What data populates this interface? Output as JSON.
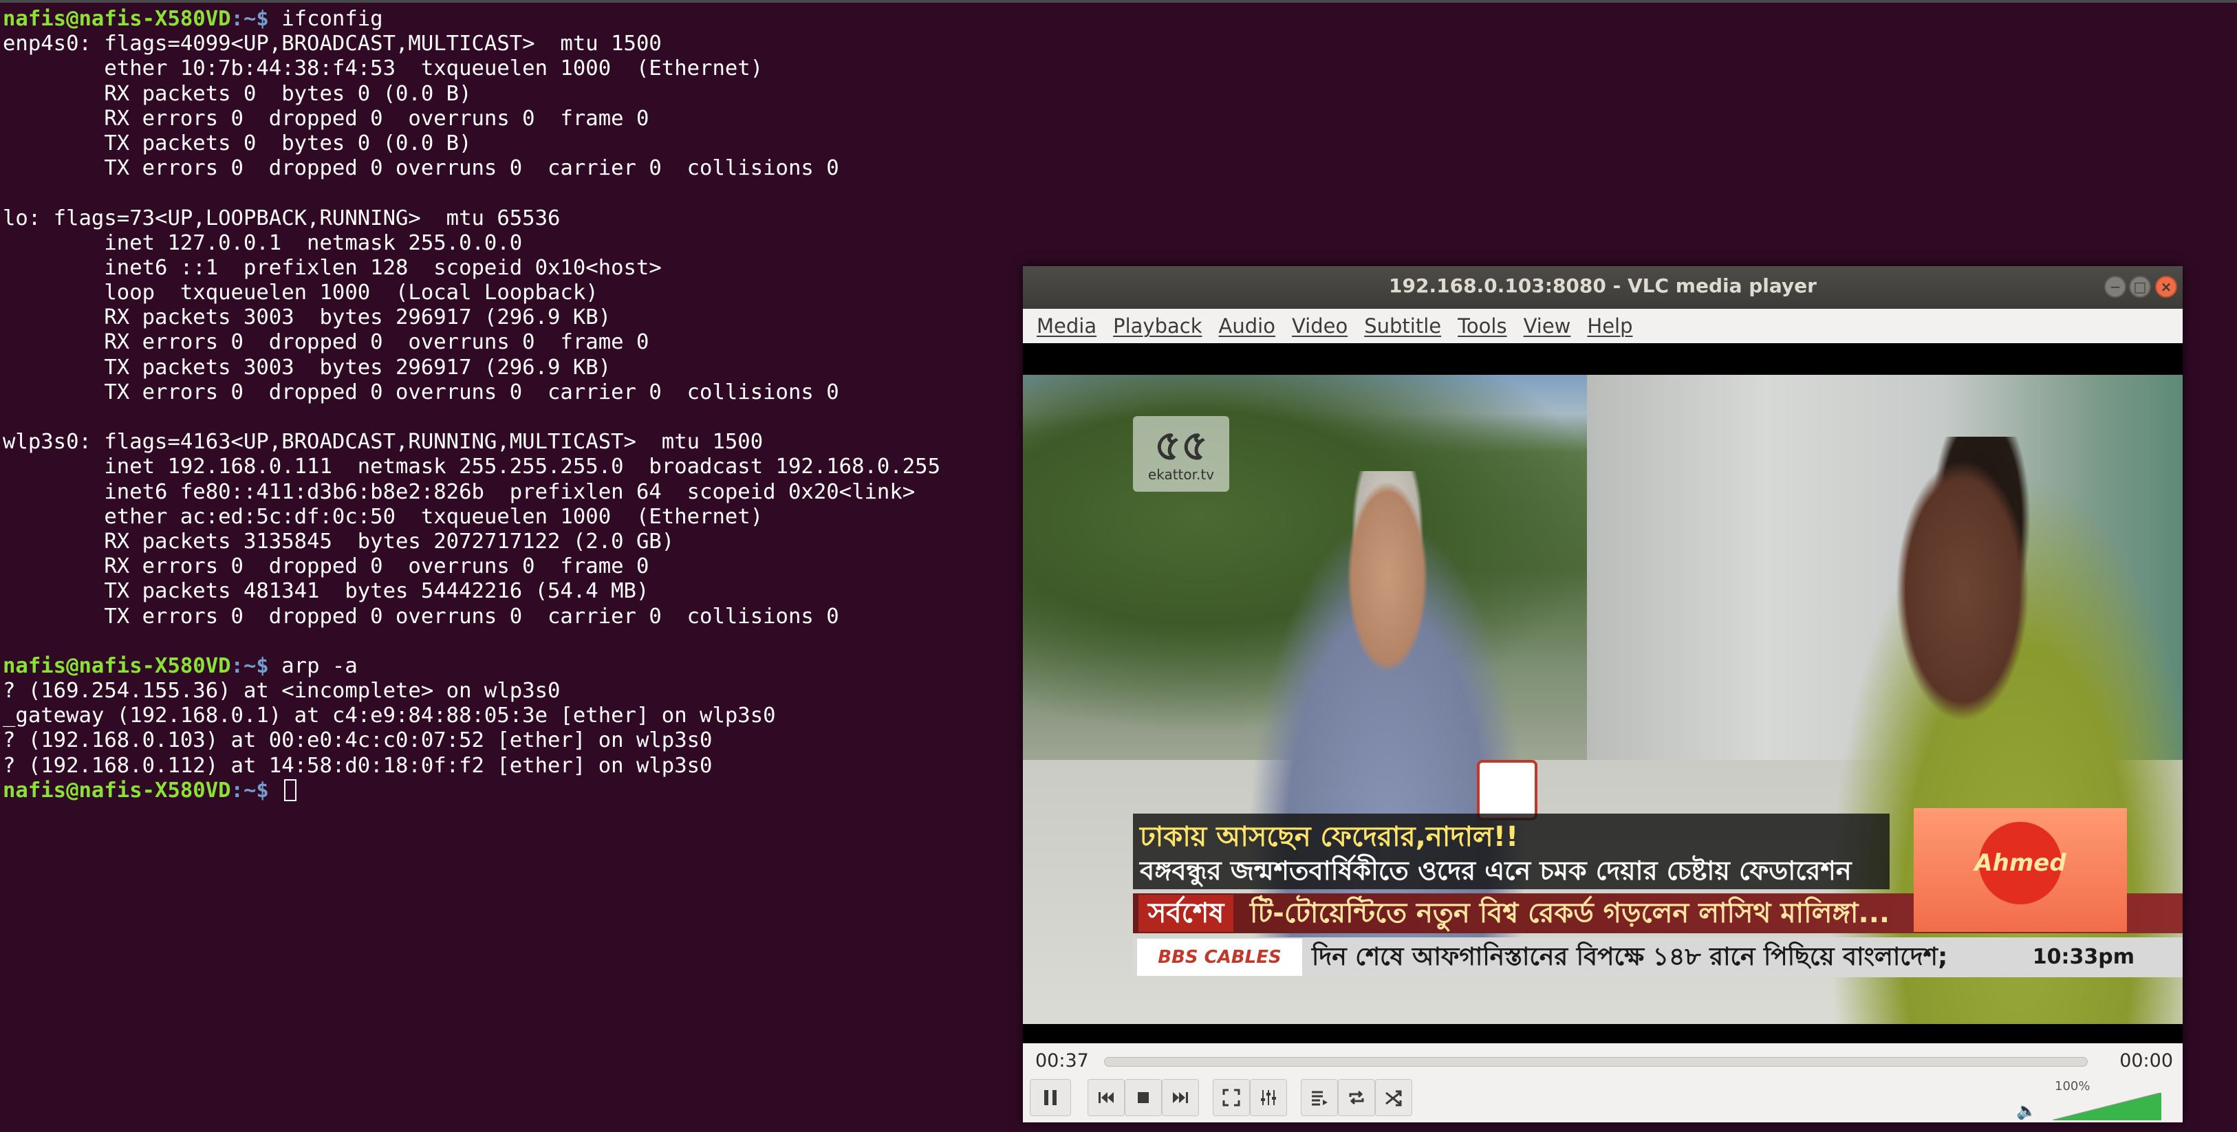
{
  "terminal": {
    "colors": {
      "background": "#300a24",
      "user": "#8ae234",
      "path": "#729fcf",
      "text": "#ffffff"
    },
    "prompt_user": "nafis@nafis-X580VD",
    "prompt_path": ":~$ ",
    "lines": [
      {
        "type": "prompt",
        "cmd": "ifconfig"
      },
      {
        "type": "out",
        "text": "enp4s0: flags=4099<UP,BROADCAST,MULTICAST>  mtu 1500"
      },
      {
        "type": "out",
        "text": "        ether 10:7b:44:38:f4:53  txqueuelen 1000  (Ethernet)"
      },
      {
        "type": "out",
        "text": "        RX packets 0  bytes 0 (0.0 B)"
      },
      {
        "type": "out",
        "text": "        RX errors 0  dropped 0  overruns 0  frame 0"
      },
      {
        "type": "out",
        "text": "        TX packets 0  bytes 0 (0.0 B)"
      },
      {
        "type": "out",
        "text": "        TX errors 0  dropped 0 overruns 0  carrier 0  collisions 0"
      },
      {
        "type": "out",
        "text": ""
      },
      {
        "type": "out",
        "text": "lo: flags=73<UP,LOOPBACK,RUNNING>  mtu 65536"
      },
      {
        "type": "out",
        "text": "        inet 127.0.0.1  netmask 255.0.0.0"
      },
      {
        "type": "out",
        "text": "        inet6 ::1  prefixlen 128  scopeid 0x10<host>"
      },
      {
        "type": "out",
        "text": "        loop  txqueuelen 1000  (Local Loopback)"
      },
      {
        "type": "out",
        "text": "        RX packets 3003  bytes 296917 (296.9 KB)"
      },
      {
        "type": "out",
        "text": "        RX errors 0  dropped 0  overruns 0  frame 0"
      },
      {
        "type": "out",
        "text": "        TX packets 3003  bytes 296917 (296.9 KB)"
      },
      {
        "type": "out",
        "text": "        TX errors 0  dropped 0 overruns 0  carrier 0  collisions 0"
      },
      {
        "type": "out",
        "text": ""
      },
      {
        "type": "out",
        "text": "wlp3s0: flags=4163<UP,BROADCAST,RUNNING,MULTICAST>  mtu 1500"
      },
      {
        "type": "out",
        "text": "        inet 192.168.0.111  netmask 255.255.255.0  broadcast 192.168.0.255"
      },
      {
        "type": "out",
        "text": "        inet6 fe80::411:d3b6:b8e2:826b  prefixlen 64  scopeid 0x20<link>"
      },
      {
        "type": "out",
        "text": "        ether ac:ed:5c:df:0c:50  txqueuelen 1000  (Ethernet)"
      },
      {
        "type": "out",
        "text": "        RX packets 3135845  bytes 2072717122 (2.0 GB)"
      },
      {
        "type": "out",
        "text": "        RX errors 0  dropped 0  overruns 0  frame 0"
      },
      {
        "type": "out",
        "text": "        TX packets 481341  bytes 54442216 (54.4 MB)"
      },
      {
        "type": "out",
        "text": "        TX errors 0  dropped 0 overruns 0  carrier 0  collisions 0"
      },
      {
        "type": "out",
        "text": ""
      },
      {
        "type": "prompt",
        "cmd": "arp -a"
      },
      {
        "type": "out",
        "text": "? (169.254.155.36) at <incomplete> on wlp3s0"
      },
      {
        "type": "out",
        "text": "_gateway (192.168.0.1) at c4:e9:84:88:05:3e [ether] on wlp3s0"
      },
      {
        "type": "out",
        "text": "? (192.168.0.103) at 00:e0:4c:c0:07:52 [ether] on wlp3s0"
      },
      {
        "type": "out",
        "text": "? (192.168.0.112) at 14:58:d0:18:0f:f2 [ether] on wlp3s0"
      },
      {
        "type": "prompt",
        "cmd": "",
        "cursor": true
      }
    ]
  },
  "vlc": {
    "title": "192.168.0.103:8080 - VLC media player",
    "window_buttons": {
      "minimize": "minimize-icon",
      "maximize": "maximize-icon",
      "close": "close-icon"
    },
    "menu": [
      "Media",
      "Playback",
      "Audio",
      "Video",
      "Subtitle",
      "Tools",
      "View",
      "Help"
    ],
    "video": {
      "channel_logo_mark": "৫৫",
      "channel_logo_text": "ekattor.tv",
      "headline_line1": "ঢাকায় আসছেন ফেদেরার,নাদাল!!",
      "headline_line2": "বঙ্গবন্ধুর জন্মশতবার্ষিকীতে ওদের এনে চমক দেয়ার চেষ্টায় ফেডারেশন",
      "latest_label": "সর্বশেষ",
      "latest_text": "টি-টোয়েন্টিতে নতুন বিশ্ব রেকর্ড গড়লেন লাসিথ মালিঙ্গা...",
      "sponsor": "BBS CABLES",
      "scroll_text": "দিন শেষে আফগানিস্তানের বিপক্ষে ১৪৮ রানে পিছিয়ে বাংলাদেশ;",
      "time_overlay": "10:33pm",
      "brand_logo": "Ahmed"
    },
    "controls": {
      "time_elapsed": "00:37",
      "time_total": "00:00",
      "volume_percent": "100%",
      "volume_level": 1.0,
      "buttons": [
        "pause-icon",
        "previous-icon",
        "stop-icon",
        "next-icon",
        "fullscreen-icon",
        "extended-settings-icon",
        "playlist-icon",
        "loop-icon",
        "shuffle-icon"
      ],
      "accent": "#3ab54a"
    }
  }
}
